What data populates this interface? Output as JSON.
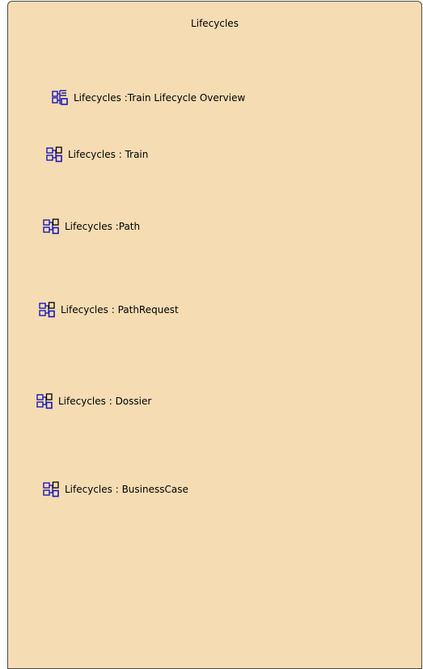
{
  "package": {
    "title": "Lifecycles"
  },
  "items": [
    {
      "label": "Lifecycles :Train Lifecycle Overview",
      "icon": "diagram-tree-icon"
    },
    {
      "label": "Lifecycles : Train",
      "icon": "state-machine-icon"
    },
    {
      "label": "Lifecycles :Path",
      "icon": "state-machine-icon"
    },
    {
      "label": "Lifecycles : PathRequest",
      "icon": "state-machine-icon"
    },
    {
      "label": "Lifecycles : Dossier",
      "icon": "state-machine-icon"
    },
    {
      "label": "Lifecycles : BusinessCase",
      "icon": "state-machine-icon"
    }
  ],
  "colors": {
    "package_fill": "#f5dcb3",
    "package_border": "#4a4a4a",
    "icon_blue": "#1a1ab8"
  }
}
